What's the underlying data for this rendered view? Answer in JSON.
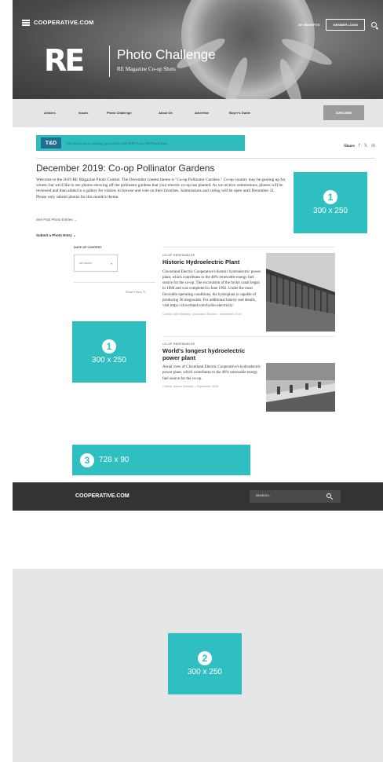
{
  "header": {
    "brand": "COOPERATIVE.COM",
    "links": [
      "MY BENEFITS",
      "MEMBER LOGIN"
    ],
    "logo_text": "RE",
    "title": "Photo Challenge",
    "subtitle": "RE Magazine Co-op Shots"
  },
  "nav": {
    "items": [
      "Articles",
      "Issues",
      "Photo Challenge",
      "About Us",
      "Advertise",
      "Buyer's Guide"
    ],
    "subscribe_label": "SUBSCRIBE"
  },
  "sponsor": {
    "logo_text": "T&D",
    "text": "This Month's photo challenge sponsored by 2020 IEEE Power T&D World Expo."
  },
  "share": {
    "label": "Share",
    "icons": [
      "facebook-icon",
      "twitter-icon",
      "linkedin-icon"
    ],
    "glyphs": [
      "f",
      "𝕏",
      "in"
    ]
  },
  "article": {
    "title": "December 2019: Co-op Pollinator Gardens",
    "intro": "Welcome to the 2019 RE Magazine Photo Contest. The December contest theme is \"Co-op Pollinator Gardens.\" Co-op country may be gearing up for winter, but we'd like to see photos showing off the pollinator gardens that your electric co-op has planted. As we receive submissions, photos will be reviewed and then added to a gallery for visitors to browse and vote on their favorites. Submissions and voting will be open until December 31. Please only submit photos for this month's theme.",
    "past_link": "See Past Photo Entries →",
    "submit_label": "Submit a Photo Entry"
  },
  "filters": {
    "label": "DATE OF CONTEST",
    "selected": "All Issues",
    "reset": "Reset Filters"
  },
  "cards": [
    {
      "category": "CO-OP RENEWABLES",
      "title": "Historic Hydroelectric Plant",
      "body": "Cloverland Electric Cooperative's historic hydroelectric power plant, which contributes to the 48% renewable energy fuel source for the co-op. The excavation of the hydro canal began in 1898 and was completed in June 1902. Under the most favorable operating conditions, the hydroplant is capable of producing 36 megawatts. For additional history and details, visit https://cloverland.com/hydro-electricity/",
      "credit": "Credits: Allie Brawley, Cloverland Electric • September 2019"
    },
    {
      "category": "CO-OP RENEWABLES",
      "title": "World's longest hydroelectric power plant",
      "body": "Aerial view of Cloverland Electric Cooperative's hydroelectric power plant, which contributes to the 48% renewable energy fuel source for the co-op.",
      "credit": "Credits: Allison Brawley • September 2019"
    }
  ],
  "ads": {
    "top": {
      "num": "1",
      "size": "300 x 250"
    },
    "mid": {
      "num": "1",
      "size": "300 x 250"
    },
    "leader": {
      "num": "3",
      "size": "728 x 90"
    },
    "bottom": {
      "num": "2",
      "size": "300 x 250"
    }
  },
  "footer": {
    "brand": "COOPERATIVE.COM",
    "search_placeholder": "SEARCH..."
  },
  "colors": {
    "ad_teal": "#2fbfc0",
    "footer_dark": "#333333",
    "nav_gray": "#e5e5e5"
  }
}
